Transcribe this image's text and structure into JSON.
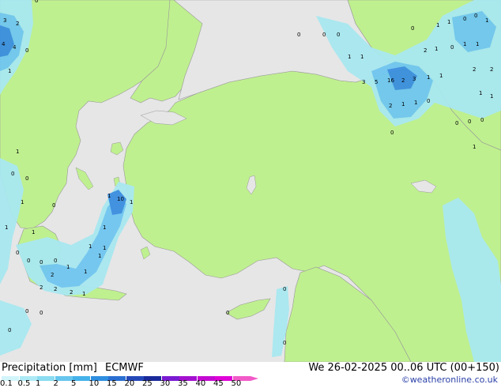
{
  "product": "Precipitation [mm]",
  "model": "ECMWF",
  "valid_time": "We 26-02-2025 00..06 UTC (00+150)",
  "credit": "©weatheronline.co.uk",
  "colors": {
    "sea": "#e6e6e6",
    "land": "#bff08f",
    "coast": "#999999",
    "precip_light": "#a8e8f0",
    "precip_mid": "#6fc6f0",
    "precip_heavy": "#3a8ee0"
  },
  "legend": {
    "ticks": [
      "0.1",
      "0.5",
      "1",
      "2",
      "5",
      "10",
      "15",
      "20",
      "25",
      "30",
      "35",
      "40",
      "45",
      "50"
    ],
    "colors": [
      "#d2f5fa",
      "#aeeaf5",
      "#8adcf0",
      "#66c6ee",
      "#45b2ea",
      "#2f8fe0",
      "#2a6fd2",
      "#2548b8",
      "#1a2a9a",
      "#7a1ad2",
      "#a410d0",
      "#c40ad2",
      "#e000d8",
      "#f25ac8"
    ]
  },
  "point_values": [
    {
      "label": "3"
    },
    {
      "label": "2"
    },
    {
      "label": "4"
    },
    {
      "label": "4"
    },
    {
      "label": "0"
    },
    {
      "label": "1"
    },
    {
      "label": "0"
    },
    {
      "label": "0"
    },
    {
      "label": "0"
    },
    {
      "label": "0"
    },
    {
      "label": "0"
    },
    {
      "label": "1"
    },
    {
      "label": "1"
    },
    {
      "label": "0"
    },
    {
      "label": "0"
    },
    {
      "label": "1"
    },
    {
      "label": "2"
    },
    {
      "label": "1"
    },
    {
      "label": "0"
    },
    {
      "label": "1"
    },
    {
      "label": "1"
    },
    {
      "label": "2"
    },
    {
      "label": "2"
    },
    {
      "label": "1"
    },
    {
      "label": "1"
    },
    {
      "label": "3"
    },
    {
      "label": "5"
    },
    {
      "label": "16"
    },
    {
      "label": "2"
    },
    {
      "label": "3"
    },
    {
      "label": "1"
    },
    {
      "label": "1"
    },
    {
      "label": "2"
    },
    {
      "label": "1"
    },
    {
      "label": "1"
    },
    {
      "label": "0"
    },
    {
      "label": "0"
    },
    {
      "label": "0"
    },
    {
      "label": "0"
    },
    {
      "label": "0"
    },
    {
      "label": "1"
    },
    {
      "label": "1"
    },
    {
      "label": "1"
    },
    {
      "label": "0"
    },
    {
      "label": "10"
    },
    {
      "label": "1"
    },
    {
      "label": "1"
    },
    {
      "label": "1"
    },
    {
      "label": "0"
    },
    {
      "label": "1"
    },
    {
      "label": "1"
    },
    {
      "label": "1"
    },
    {
      "label": "2"
    },
    {
      "label": "1"
    },
    {
      "label": "1"
    },
    {
      "label": "2"
    },
    {
      "label": "2"
    },
    {
      "label": "2"
    },
    {
      "label": "1"
    },
    {
      "label": "0"
    },
    {
      "label": "0"
    },
    {
      "label": "0"
    },
    {
      "label": "1"
    },
    {
      "label": "1"
    },
    {
      "label": "0"
    },
    {
      "label": "0"
    },
    {
      "label": "0"
    },
    {
      "label": "0"
    },
    {
      "label": "0"
    },
    {
      "label": "0"
    },
    {
      "label": "0"
    },
    {
      "label": "1"
    },
    {
      "label": "1"
    },
    {
      "label": "0"
    },
    {
      "label": "0"
    }
  ]
}
